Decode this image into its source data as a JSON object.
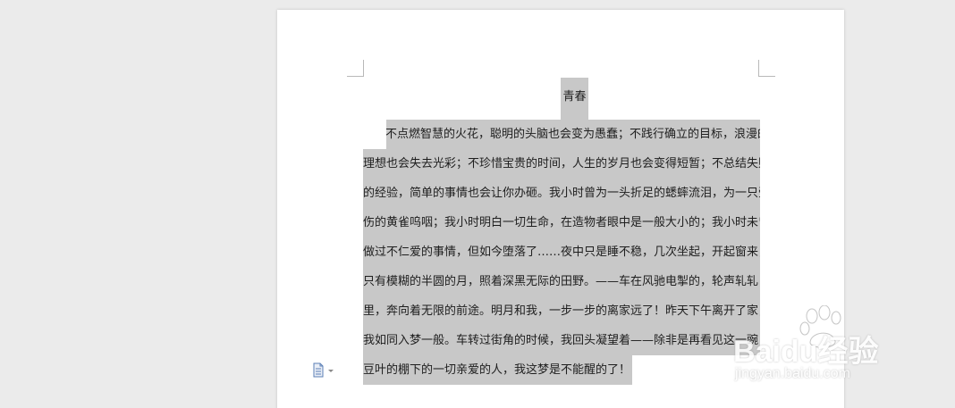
{
  "document": {
    "title": "青春",
    "lines": [
      "不点燃智慧的火花，聪明的头脑也会变为愚蠢；不践行确立的目标，浪漫的",
      "理想也会失去光彩；不珍惜宝贵的时间，人生的岁月也会变得短暂；不总结失败",
      "的经验，简单的事情也会让你办砸。我小时曾为一头折足的蟋蟀流泪，为一只受",
      "伤的黄雀呜咽；我小时明白一切生命，在造物者眼中是一般大小的；我小时未曾",
      "做过不仁爱的事情，但如今堕落了……夜中只是睡不稳，几次坐起，开起窗来，",
      "只有模糊的半圆的月，照着深黑无际的田野。——车在风驰电掣的，轮声轧轧",
      "里，奔向着无限的前途。明月和我，一步一步的离家远了！昨天下午离开了家，",
      "我如同入梦一般。车转过街角的时候，我回头凝望着——除非是再看见这一豌",
      "豆叶的棚下的一切亲爱的人，我这梦是不能醒的了！"
    ]
  },
  "colors": {
    "selection": "#c8c8c8",
    "page": "#ffffff",
    "workspace": "#ebebeb"
  },
  "icons": {
    "paste_options": "paste-options-icon"
  },
  "watermark": {
    "logo": "Baidu经验",
    "url": "jingyan.baidu.com"
  }
}
